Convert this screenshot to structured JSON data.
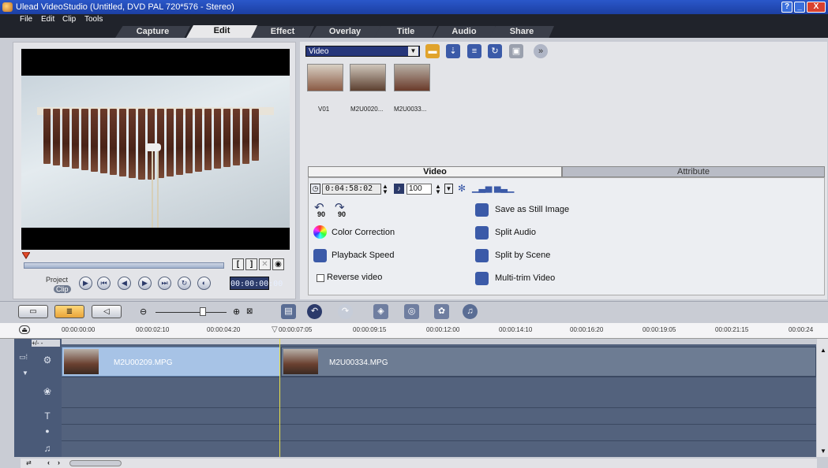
{
  "window": {
    "title": "Ulead VideoStudio (Untitled, DVD PAL 720*576 - Stereo)",
    "help_label": "?",
    "min_label": "_",
    "close_label": "X"
  },
  "menu": [
    "File",
    "Edit",
    "Clip",
    "Tools"
  ],
  "step_tabs": [
    "Capture",
    "Edit",
    "Effect",
    "Overlay",
    "Title",
    "Audio",
    "Share"
  ],
  "preview": {
    "project_label": "Project",
    "clip_label": "Clip",
    "timecode": "00:00:00:00",
    "mark_in": "[",
    "mark_out": "]"
  },
  "library": {
    "selected": "Video",
    "thumbnails": [
      "V01",
      "M2U0020...",
      "M2U0033..."
    ]
  },
  "options": {
    "tab_video": "Video",
    "tab_attribute": "Attribute",
    "duration": "0:04:58:02",
    "volume": "100",
    "rotate_left": "90",
    "rotate_right": "90",
    "color_correction": "Color Correction",
    "playback_speed": "Playback Speed",
    "reverse_video": "Reverse video",
    "save_still": "Save as Still Image",
    "split_audio": "Split Audio",
    "split_by_scene": "Split by Scene",
    "multi_trim": "Multi-trim Video"
  },
  "timeline": {
    "ruler": [
      "00:00:00:00",
      "00:00:02:10",
      "00:00:04:20",
      "00:00:07:05",
      "00:00:09:15",
      "00:00:12:00",
      "00:00:14:10",
      "00:00:16:20",
      "00:00:19:05",
      "00:00:21:15",
      "00:00:24"
    ],
    "clips": [
      "M2U00209.MPG",
      "M2U00334.MPG"
    ],
    "zoom_sign": "+/- -"
  }
}
